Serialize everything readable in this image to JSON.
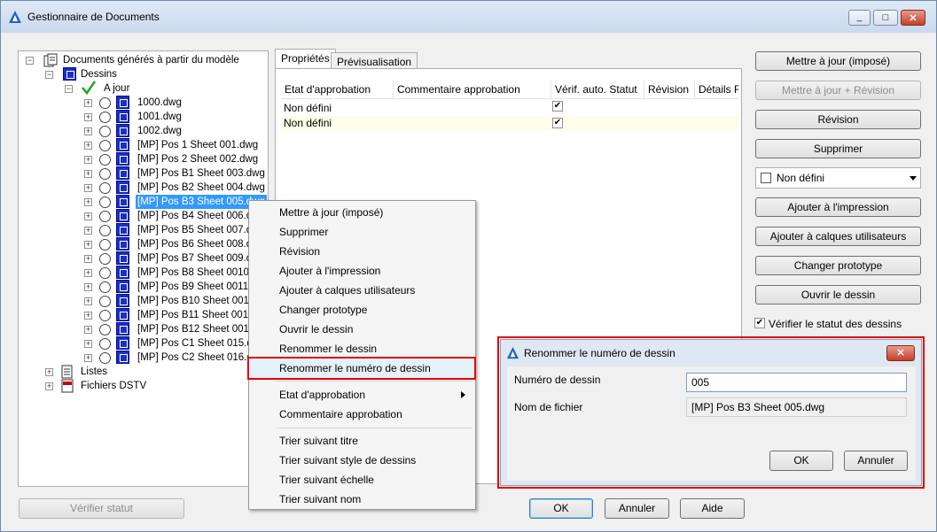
{
  "window": {
    "title": "Gestionnaire de Documents",
    "minimize_glyph": "_",
    "maximize_glyph": "□",
    "close_glyph": "✕"
  },
  "tree": {
    "root_label": "Documents générés à partir du modèle",
    "dessins_label": "Dessins",
    "ajour_label": "A jour",
    "files": [
      "1000.dwg",
      "1001.dwg",
      "1002.dwg",
      "[MP] Pos 1 Sheet 001.dwg",
      "[MP] Pos 2 Sheet 002.dwg",
      "[MP] Pos B1 Sheet 003.dwg",
      "[MP] Pos B2 Sheet 004.dwg",
      "[MP] Pos B3 Sheet 005.dwg",
      "[MP] Pos B4 Sheet 006.dwg",
      "[MP] Pos B5 Sheet 007.dwg",
      "[MP] Pos B6 Sheet 008.dwg",
      "[MP] Pos B7 Sheet 009.dwg",
      "[MP] Pos B8 Sheet 0010.dwg",
      "[MP] Pos B9 Sheet 0011.dwg",
      "[MP] Pos B10 Sheet 0012.dwg",
      "[MP] Pos B11 Sheet 0013.dwg",
      "[MP] Pos B12 Sheet 0014.dwg",
      "[MP] Pos C1 Sheet 015.dwg",
      "[MP] Pos C2 Sheet 016.dwg"
    ],
    "selected_index": 7,
    "listes_label": "Listes",
    "dstv_label": "Fichiers DSTV"
  },
  "tabs": [
    "Propriétés",
    "Prévisualisation"
  ],
  "grid": {
    "columns": [
      "Etat d'approbation",
      "Commentaire approbation",
      "Vérif. auto. Statut",
      "Révision",
      "Détails F"
    ],
    "rows": [
      {
        "etat": "Non défini",
        "checked": true
      },
      {
        "etat": "Non défini",
        "checked": true
      }
    ]
  },
  "right_buttons": {
    "update_forced": "Mettre à jour (imposé)",
    "update_revision": "Mettre à jour + Révision",
    "revision": "Révision",
    "delete": "Supprimer",
    "combo_value": "Non défini",
    "add_print": "Ajouter à l'impression",
    "add_user_layers": "Ajouter à calques utilisateurs",
    "change_prototype": "Changer prototype",
    "open_drawing": "Ouvrir le dessin",
    "verify_status_checkbox": "Vérifier le statut des dessins"
  },
  "bottom": {
    "verify_status": "Vérifier statut",
    "ok": "OK",
    "cancel": "Annuler",
    "help": "Aide"
  },
  "context_menu": {
    "items_group1": [
      "Mettre à jour (imposé)",
      "Supprimer",
      "Révision",
      "Ajouter à l'impression",
      "Ajouter à calques utilisateurs",
      "Changer prototype",
      "Ouvrir le dessin",
      "Renommer le dessin",
      "Renommer le numéro de dessin"
    ],
    "items_group2": [
      "Etat d'approbation",
      "Commentaire approbation"
    ],
    "items_group3": [
      "Trier suivant titre",
      "Trier suivant style de dessins",
      "Trier suivant échelle",
      "Trier suivant nom"
    ],
    "highlighted": "Renommer le numéro de dessin"
  },
  "rename_dialog": {
    "title": "Renommer le numéro de dessin",
    "number_label": "Numéro de dessin",
    "number_value": "005",
    "filename_label": "Nom de fichier",
    "filename_value": "[MP] Pos B3 Sheet 005.dwg",
    "ok": "OK",
    "cancel": "Annuler"
  },
  "colors": {
    "highlight": "#e60000",
    "selection": "#3399ff",
    "dwg_icon": "#1a2ec8"
  }
}
